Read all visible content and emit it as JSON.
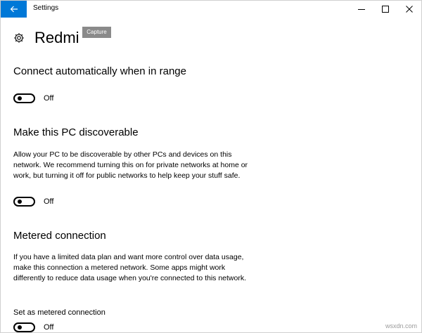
{
  "window": {
    "title": "Settings"
  },
  "page": {
    "title": "Redmi",
    "capture_badge": "Capture"
  },
  "sections": {
    "connect": {
      "title": "Connect automatically when in range",
      "toggle_label": "Off",
      "toggle_on": false
    },
    "discoverable": {
      "title": "Make this PC discoverable",
      "description": "Allow your PC to be discoverable by other PCs and devices on this network. We recommend turning this on for private networks at home or work, but turning it off for public networks to help keep your stuff safe.",
      "toggle_label": "Off",
      "toggle_on": false
    },
    "metered": {
      "title": "Metered connection",
      "description": "If you have a limited data plan and want more control over data usage, make this connection a metered network. Some apps might work differently to reduce data usage when you're connected to this network.",
      "set_label": "Set as metered connection",
      "toggle_label": "Off",
      "toggle_on": false
    }
  },
  "watermark": "wsxdn.com",
  "colors": {
    "accent": "#0078d7",
    "badge": "#8a8a8a"
  },
  "icons": [
    "back-arrow-icon",
    "minimize-icon",
    "maximize-icon",
    "close-icon",
    "gear-icon"
  ]
}
